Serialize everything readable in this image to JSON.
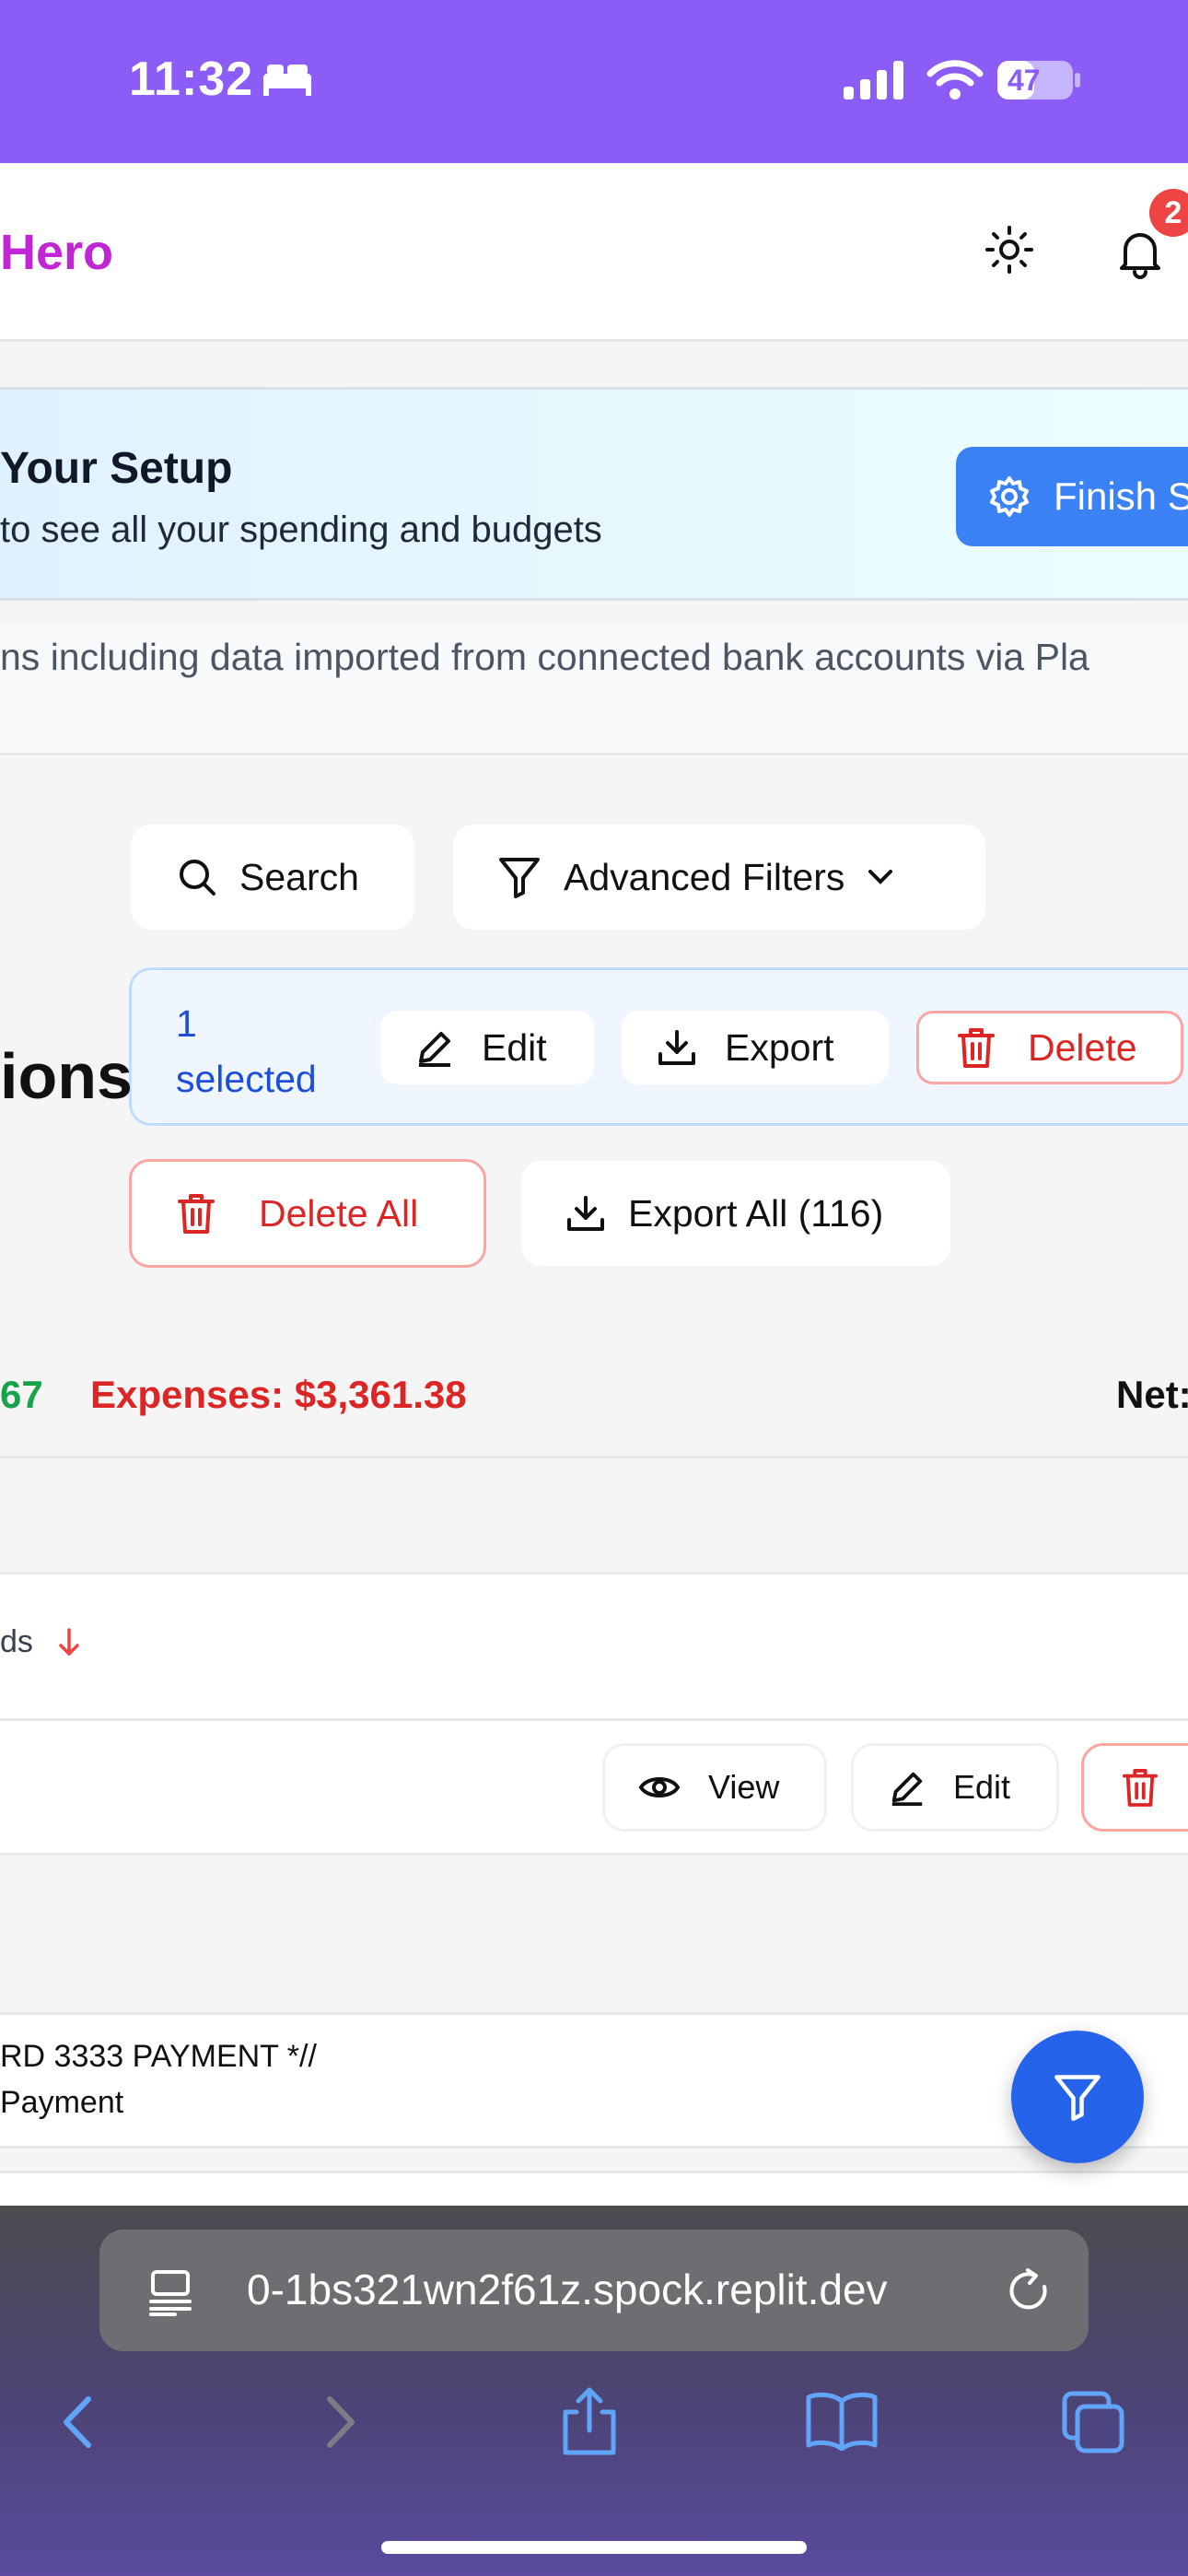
{
  "status_bar": {
    "time": "11:32",
    "battery": "47"
  },
  "header": {
    "brand": "Hero",
    "notification_count": "2"
  },
  "setup_banner": {
    "title": "Your Setup",
    "subtitle": "to see all your spending and budgets",
    "button_label": "Finish S"
  },
  "description": "ns including data imported from connected bank accounts via Pla",
  "toolbar": {
    "search_label": "Search",
    "filters_label": "Advanced Filters"
  },
  "selection_bar": {
    "count": "1",
    "selected_label": "selected",
    "edit_label": "Edit",
    "export_label": "Export",
    "delete_label": "Delete"
  },
  "page_heading": "ions",
  "bulk_actions": {
    "delete_all_label": "Delete All",
    "export_all_label": "Export All (116)"
  },
  "summary": {
    "income": "67",
    "expenses": "Expenses: $3,361.38",
    "net": "Net:"
  },
  "table": {
    "header_label": "ds",
    "row_actions": {
      "view_label": "View",
      "edit_label": "Edit"
    },
    "rows": [
      {
        "title": "RD 3333 PAYMENT *//",
        "subtitle": "Payment"
      }
    ]
  },
  "browser": {
    "url": "0-1bs321wn2f61z.spock.replit.dev"
  },
  "colors": {
    "status_bar": "#8b5cf6",
    "brand": "#c026d3",
    "primary": "#3b82f6",
    "danger": "#dc2626",
    "income": "#16a34a",
    "fab": "#2563eb"
  }
}
